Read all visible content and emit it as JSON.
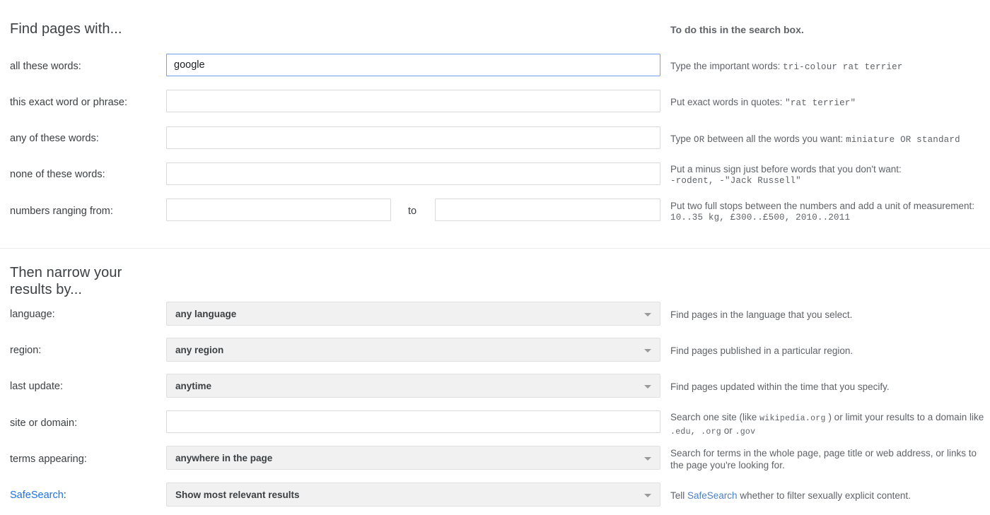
{
  "headings": {
    "find_pages_with": "Find pages with...",
    "then_narrow": "Then narrow your results by...",
    "search_box_column": "To do this in the search box."
  },
  "find_section": {
    "rows": [
      {
        "label": "all these words:",
        "input_value": "google",
        "placeholder": "",
        "focused": true,
        "hint_prefix": "Type the important words: ",
        "hint_mono": "tri-colour rat terrier",
        "hint_suffix": ""
      },
      {
        "label": "this exact word or phrase:",
        "input_value": "",
        "placeholder": "",
        "focused": false,
        "hint_prefix": "Put exact words in quotes: ",
        "hint_mono": "\"rat terrier\"",
        "hint_suffix": ""
      },
      {
        "label": "any of these words:",
        "input_value": "",
        "placeholder": "",
        "focused": false,
        "hint_prefix": "Type ",
        "hint_mono": "OR",
        "hint_middle": " between all the words you want: ",
        "hint_mono2": "miniature OR standard",
        "hint_suffix": ""
      },
      {
        "label": "none of these words:",
        "input_value": "",
        "placeholder": "",
        "focused": false,
        "hint_line1": "Put a minus sign just before words that you don't want:",
        "hint_mono": "-rodent, -\"Jack Russell\""
      },
      {
        "label": "numbers ranging from:",
        "input_value": "",
        "input_value_to": "",
        "separator": "to",
        "focused": false,
        "hint_line1": "Put two full stops between the numbers and add a unit of measurement:",
        "hint_mono": "10..35 kg, £300..£500, 2010..2011"
      }
    ]
  },
  "narrow_section": {
    "rows": [
      {
        "label": "language:",
        "type": "select",
        "value": "any language",
        "hint": "Find pages in the language that you select."
      },
      {
        "label": "region:",
        "type": "select",
        "value": "any region",
        "hint": "Find pages published in a particular region."
      },
      {
        "label": "last update:",
        "type": "select",
        "value": "anytime",
        "hint": "Find pages updated within the time that you specify."
      },
      {
        "label": "site or domain:",
        "type": "text",
        "value": "",
        "hint_prefix": "Search one site (like ",
        "hint_mono": "wikipedia.org",
        "hint_middle": " ) or limit your results to a domain like ",
        "hint_mono2": ".edu, .org",
        "hint_middle2": " or ",
        "hint_mono3": ".gov"
      },
      {
        "label": "terms appearing:",
        "type": "select",
        "value": "anywhere in the page",
        "hint": "Search for terms in the whole page, page title or web address, or links to the page you're looking for."
      },
      {
        "label": "SafeSearch:",
        "label_is_link": true,
        "label_link_text": "SafeSearch",
        "type": "select",
        "value": "Show most relevant results",
        "hint_prefix": "Tell ",
        "hint_link": "SafeSearch",
        "hint_suffix": " whether to filter sexually explicit content."
      }
    ]
  },
  "icons": {
    "dropdown_caret": "chevron-down-icon"
  },
  "colors": {
    "link_blue": "#1a73e8",
    "hint_gray": "#5f6368",
    "focus_border": "#74a2e8",
    "select_bg": "#f1f1f1",
    "divider": "#ebebeb"
  }
}
